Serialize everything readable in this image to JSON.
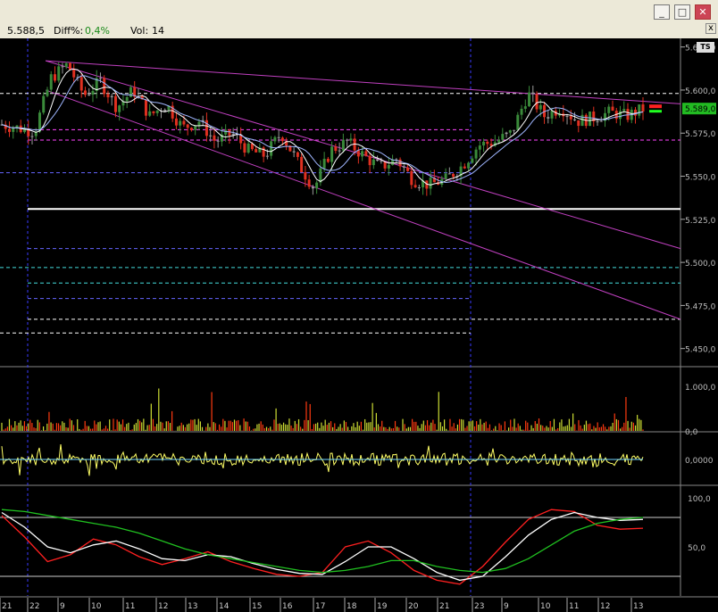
{
  "window": {
    "min_glyph": "_",
    "max_glyph": "□",
    "close_glyph": "✕",
    "panel_close_glyph": "x"
  },
  "infobar": {
    "last_value": "5.588,5",
    "diff_label": "Diff%:",
    "diff_value": "0,4%",
    "vol_label": "Vol:",
    "vol_value": "14"
  },
  "ts_badge": "TS",
  "colors": {
    "background": "#000000",
    "up_candle": "#3a8a3a",
    "down_candle": "#e03020",
    "neutral_candle": "#9a9a9a",
    "channel": "#c040c0",
    "price_tag": "#22bb22",
    "stoch_k": "#ff2020",
    "stoch_d": "#ffffff",
    "stoch_slow": "#20c020",
    "oscillator": "#ffff66"
  },
  "chart_data": [
    {
      "type": "candlestick",
      "panel": "price",
      "ylim": [
        5440,
        5630
      ],
      "y_ticks": [
        "5.625,0",
        "5.600,0",
        "5.575,0",
        "5.550,0",
        "5.525,0",
        "5.500,0",
        "5.475,0",
        "5.450,0"
      ],
      "y_tick_values": [
        5625,
        5600,
        5575,
        5550,
        5525,
        5500,
        5475,
        5450
      ],
      "last_price_tag": "5.589,0",
      "last_price": 5589,
      "x_labels": [
        "21",
        "22",
        "9",
        "10",
        "11",
        "12",
        "13",
        "14",
        "15",
        "16",
        "17",
        "18",
        "19",
        "20",
        "21",
        "23",
        "9",
        "10",
        "11",
        "12",
        "13"
      ],
      "swing_path": [
        5580,
        5578,
        5576,
        5607,
        5615,
        5597,
        5605,
        5590,
        5600,
        5585,
        5592,
        5578,
        5582,
        5570,
        5575,
        5565,
        5562,
        5575,
        5558,
        5543,
        5565,
        5570,
        5562,
        5555,
        5560,
        5548,
        5545,
        5548,
        5556,
        5568,
        5570,
        5575,
        5598,
        5585,
        5590,
        5582,
        5584,
        5587,
        5585,
        5589
      ],
      "channel_lines": [
        {
          "from": [
            0.086,
            5617
          ],
          "to": [
            1.0,
            5592
          ]
        },
        {
          "from": [
            0.086,
            5617
          ],
          "to": [
            1.0,
            5508
          ]
        },
        {
          "from": [
            0.086,
            5600
          ],
          "to": [
            1.0,
            5467
          ]
        }
      ],
      "levels": [
        5598,
        5577,
        5571,
        5552,
        5531,
        5508,
        5497,
        5479,
        5467,
        5459,
        5488
      ]
    },
    {
      "type": "bar",
      "panel": "volume",
      "y_ticks": [
        "1.000,0",
        "0,0"
      ],
      "y_tick_values": [
        1000,
        0
      ],
      "ylim": [
        0,
        1400
      ]
    },
    {
      "type": "line",
      "panel": "oscillator",
      "y_ticks": [
        "0,0000"
      ],
      "y_tick_values": [
        0
      ]
    },
    {
      "type": "line",
      "panel": "stochastic",
      "y_ticks": [
        "100,0",
        "50,0"
      ],
      "y_tick_values": [
        100,
        50
      ],
      "ylim": [
        0,
        110
      ],
      "reference_levels": [
        80,
        20
      ],
      "series": [
        {
          "values": [
            82,
            60,
            35,
            42,
            58,
            52,
            40,
            32,
            38,
            45,
            35,
            28,
            22,
            20,
            24,
            50,
            56,
            44,
            26,
            16,
            12,
            30,
            55,
            78,
            88,
            86,
            72,
            68,
            69
          ]
        },
        {
          "values": [
            85,
            70,
            50,
            44,
            52,
            56,
            48,
            38,
            36,
            42,
            40,
            33,
            27,
            23,
            22,
            35,
            50,
            50,
            38,
            24,
            16,
            20,
            40,
            62,
            78,
            85,
            80,
            77,
            78
          ]
        },
        {
          "values": [
            88,
            86,
            82,
            78,
            74,
            70,
            64,
            56,
            48,
            42,
            38,
            34,
            30,
            26,
            24,
            26,
            30,
            36,
            36,
            30,
            26,
            24,
            28,
            38,
            52,
            66,
            74,
            78,
            80
          ]
        }
      ]
    }
  ]
}
